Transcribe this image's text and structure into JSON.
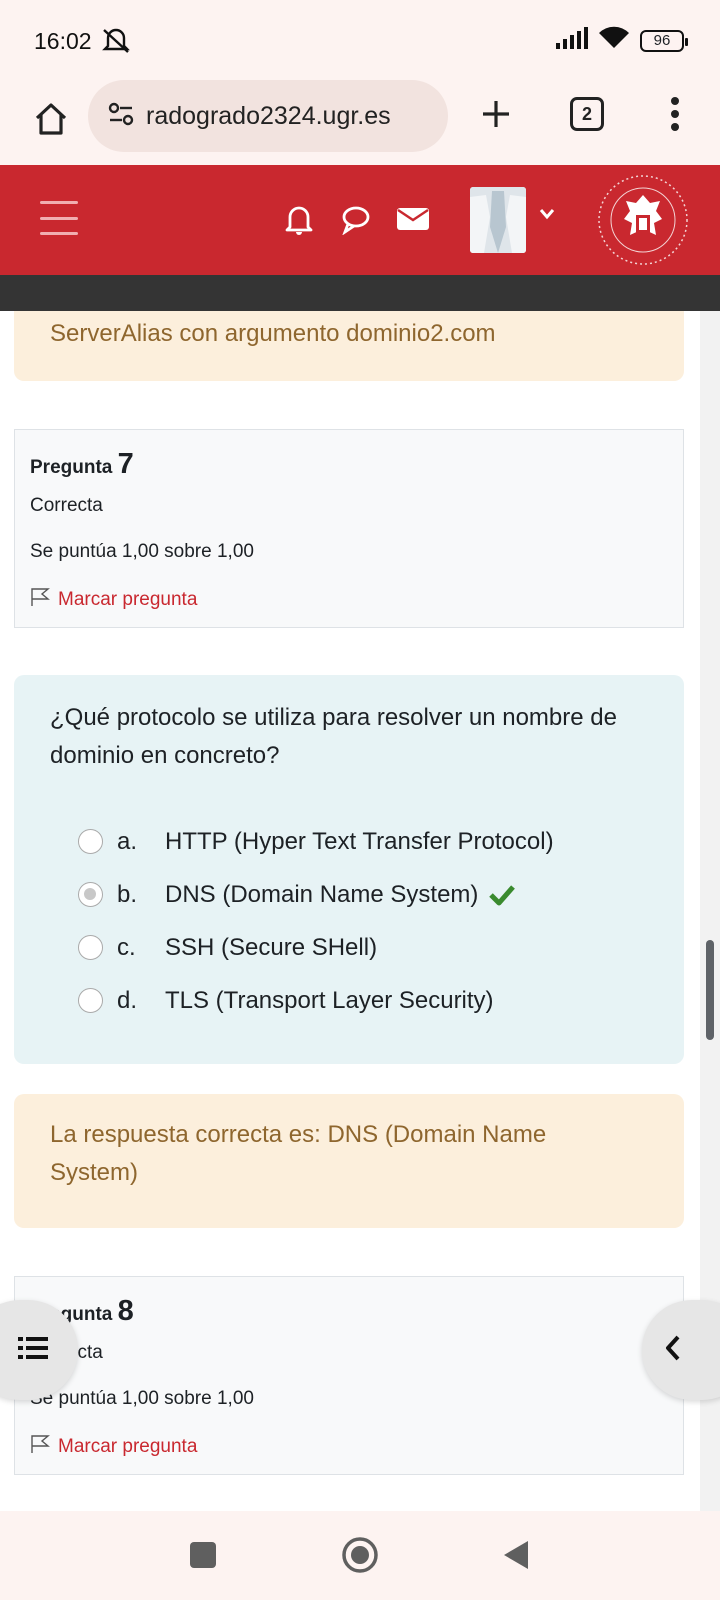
{
  "status_bar": {
    "time": "16:02",
    "battery": "96",
    "icons": [
      "mute-icon",
      "signal-icon",
      "wifi-icon",
      "battery-icon"
    ]
  },
  "browser": {
    "url": "radogrado2324.ugr.es",
    "tab_count": "2",
    "icons": [
      "home-icon",
      "site-settings-icon",
      "new-tab-icon",
      "tabs-icon",
      "menu-icon"
    ]
  },
  "site_header": {
    "icons": [
      "menu-icon",
      "bell-icon",
      "chat-icon",
      "mail-icon",
      "avatar",
      "chevron-down-icon",
      "university-seal"
    ],
    "seal_text": "UNIVERSITAS GRANATENSIS 1531"
  },
  "feedback_prev": {
    "text": "ServerAlias con argumento dominio2.com"
  },
  "question7": {
    "title_label": "Pregunta",
    "number": "7",
    "state": "Correcta",
    "grade": "Se puntúa 1,00 sobre 1,00",
    "flag_label": "Marcar pregunta",
    "text": "¿Qué protocolo se utiliza para resolver un nombre de dominio en concreto?",
    "answers": [
      {
        "letter": "a.",
        "text": "HTTP (Hyper Text Transfer Protocol)",
        "selected": false,
        "correct": false
      },
      {
        "letter": "b.",
        "text": "DNS (Domain Name System)",
        "selected": true,
        "correct": true
      },
      {
        "letter": "c.",
        "text": "SSH (Secure SHell)",
        "selected": false,
        "correct": false
      },
      {
        "letter": "d.",
        "text": "TLS (Transport Layer Security)",
        "selected": false,
        "correct": false
      }
    ],
    "feedback": "La respuesta correcta es: DNS (Domain Name System)"
  },
  "question8": {
    "title_label": "Pregunta",
    "number": "8",
    "state": "Correcta",
    "grade": "Se puntúa 1,00 sobre 1,00",
    "flag_label": "Marcar pregunta"
  },
  "colors": {
    "brand_red": "#c9282f",
    "feedback_bg": "#fcefdc",
    "feedback_text": "#8e662e",
    "question_bg": "#e7f3f5",
    "correct_green": "#3a8a2e"
  }
}
